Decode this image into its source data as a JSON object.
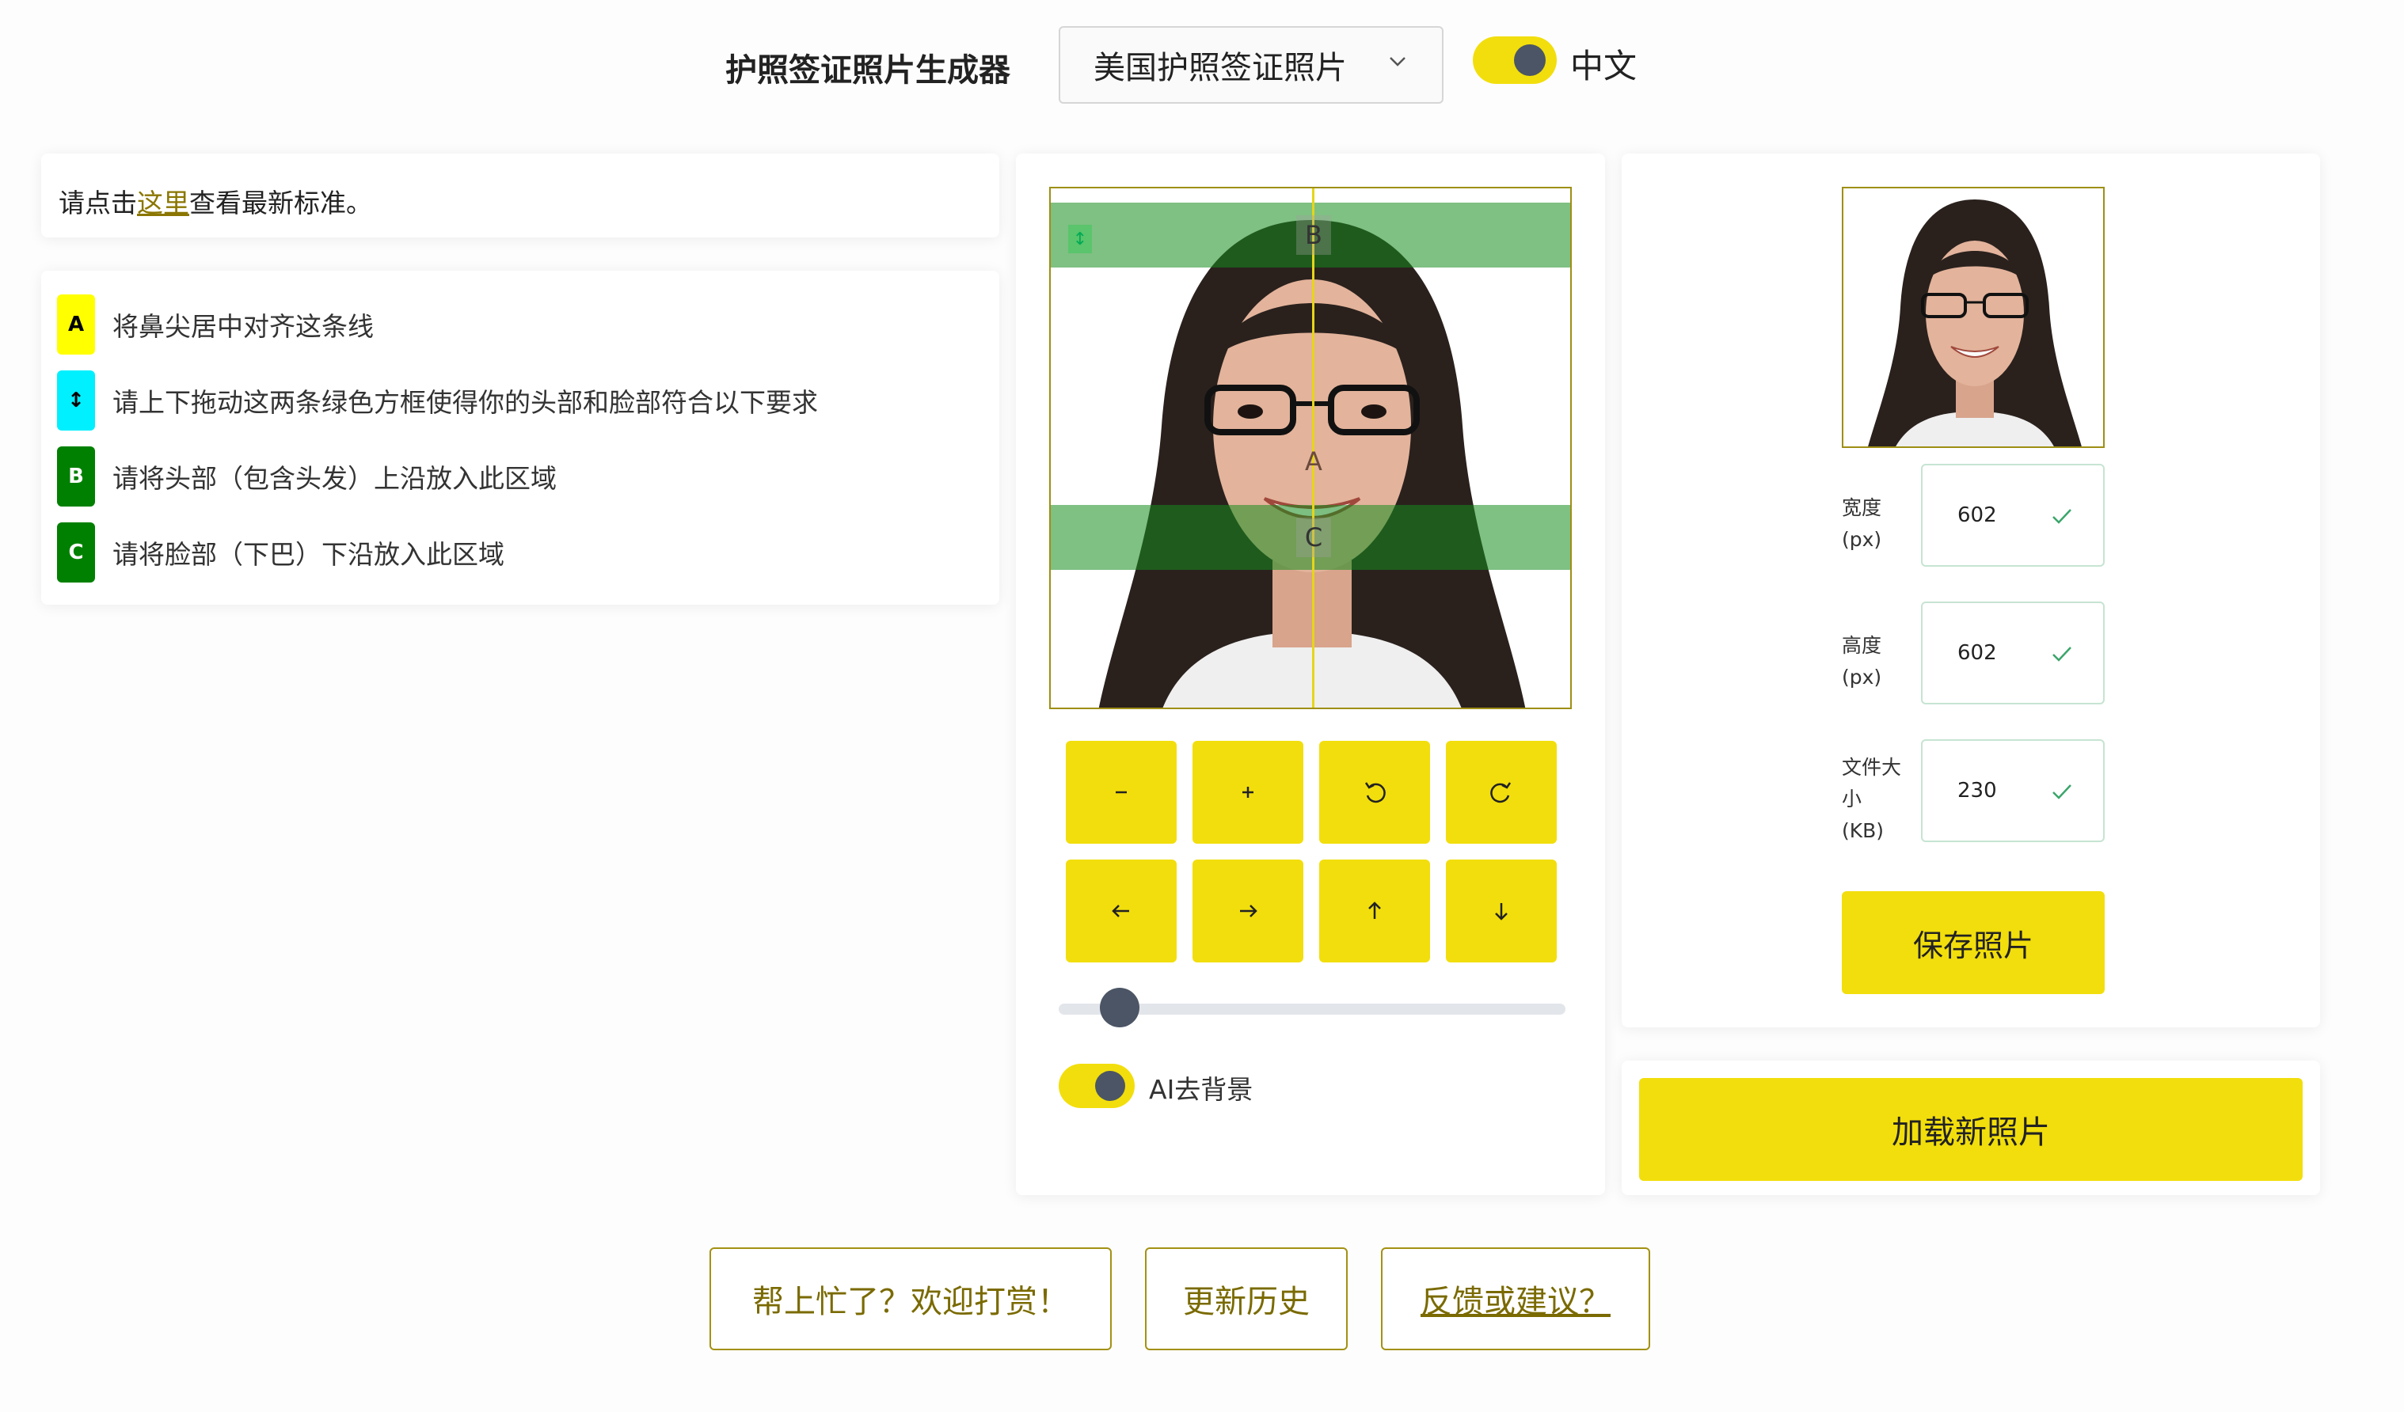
{
  "header": {
    "title": "护照签证照片生成器",
    "document_type": "美国护照签证照片",
    "language_label": "中文",
    "language_toggle_on": true
  },
  "notice": {
    "prefix": "请点击",
    "link": "这里",
    "suffix": "查看最新标准。"
  },
  "legend": [
    {
      "badge": "A",
      "text": "将鼻尖居中对齐这条线",
      "color": "#ffff00",
      "text_color": "#000000"
    },
    {
      "badge": "↕",
      "text": "请上下拖动这两条绿色方框使得你的头部和脸部符合以下要求",
      "color": "#00f0ff",
      "text_color": "#000000"
    },
    {
      "badge": "B",
      "text": "请将头部（包含头发）上沿放入此区域",
      "color": "#008000",
      "text_color": "#ffffff"
    },
    {
      "badge": "C",
      "text": "请将脸部（下巴）下沿放入此区域",
      "color": "#008000",
      "text_color": "#ffffff"
    }
  ],
  "editor": {
    "markers": {
      "a": "A",
      "b": "B",
      "c": "C"
    },
    "controls": [
      {
        "icon": "minus-icon",
        "action": "zoom-out"
      },
      {
        "icon": "plus-icon",
        "action": "zoom-in"
      },
      {
        "icon": "rotate-left-icon",
        "action": "rotate-left"
      },
      {
        "icon": "rotate-right-icon",
        "action": "rotate-right"
      },
      {
        "icon": "arrow-left-icon",
        "action": "move-left"
      },
      {
        "icon": "arrow-right-icon",
        "action": "move-right"
      },
      {
        "icon": "arrow-up-icon",
        "action": "move-up"
      },
      {
        "icon": "arrow-down-icon",
        "action": "move-down"
      }
    ],
    "zoom_level_fraction": 0.12,
    "ai_bg_label": "AI去背景",
    "ai_bg_on": true
  },
  "preview": {
    "fields": [
      {
        "label_lines": [
          "宽度",
          "(px)"
        ],
        "value": "602"
      },
      {
        "label_lines": [
          "高度",
          "(px)"
        ],
        "value": "602"
      },
      {
        "label_lines": [
          "文件大",
          "小",
          "(KB)"
        ],
        "value": "230"
      }
    ],
    "save_label": "保存照片",
    "load_label": "加载新照片"
  },
  "footer": {
    "donate": "帮上忙了？欢迎打赏！",
    "history": "更新历史",
    "feedback": "反馈或建议？"
  },
  "colors": {
    "accent": "#f2de0c",
    "guide_band": "#168c1e",
    "knob": "#4b5565",
    "link": "#8a7600"
  }
}
